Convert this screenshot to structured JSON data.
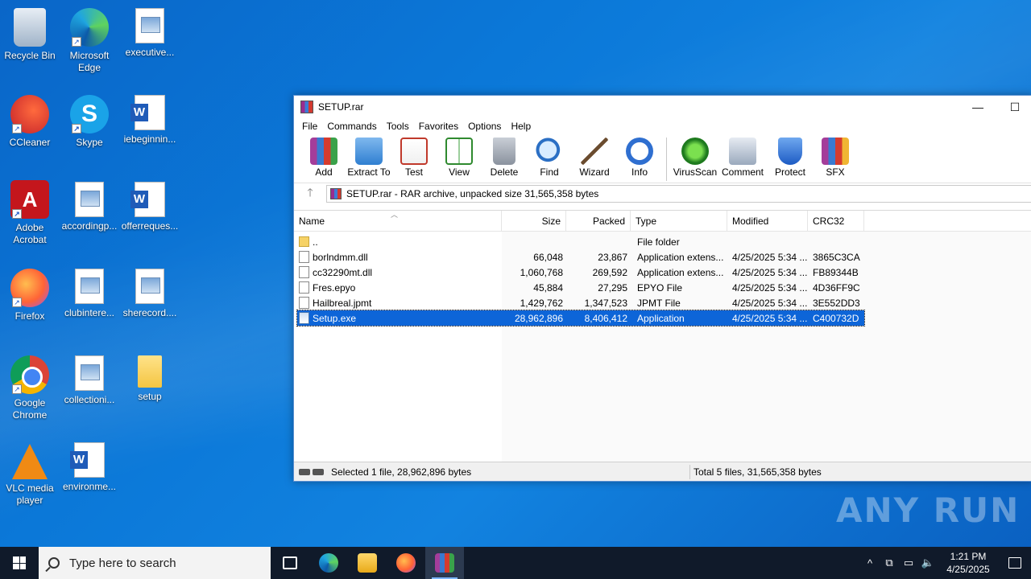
{
  "desktop": {
    "icons": [
      {
        "label": "Recycle Bin",
        "icon": "recycle-bin-icon"
      },
      {
        "label": "Microsoft Edge",
        "icon": "edge-icon"
      },
      {
        "label": "executive...",
        "icon": "image-file-icon"
      },
      {
        "label": "CCleaner",
        "icon": "ccleaner-icon"
      },
      {
        "label": "Skype",
        "icon": "skype-icon"
      },
      {
        "label": "iebeginnin...",
        "icon": "word-doc-icon"
      },
      {
        "label": "Adobe Acrobat",
        "icon": "acrobat-icon"
      },
      {
        "label": "accordingp...",
        "icon": "image-file-icon"
      },
      {
        "label": "offerreques...",
        "icon": "word-doc-icon"
      },
      {
        "label": "Firefox",
        "icon": "firefox-icon"
      },
      {
        "label": "clubintere...",
        "icon": "image-file-icon"
      },
      {
        "label": "sherecord....",
        "icon": "image-file-icon"
      },
      {
        "label": "Google Chrome",
        "icon": "chrome-icon"
      },
      {
        "label": "collectioni...",
        "icon": "image-file-icon"
      },
      {
        "label": "setup",
        "icon": "folder-icon"
      },
      {
        "label": "VLC media player",
        "icon": "vlc-icon"
      },
      {
        "label": "environme...",
        "icon": "word-doc-icon"
      }
    ]
  },
  "window": {
    "title": "SETUP.rar",
    "controls": {
      "minimize": "—",
      "maximize": "☐"
    },
    "menu": [
      "File",
      "Commands",
      "Tools",
      "Favorites",
      "Options",
      "Help"
    ],
    "toolbar": [
      {
        "label": "Add",
        "icon": "add-archive-icon"
      },
      {
        "label": "Extract To",
        "icon": "extract-folder-icon"
      },
      {
        "label": "Test",
        "icon": "test-clipboard-icon"
      },
      {
        "label": "View",
        "icon": "view-book-icon"
      },
      {
        "label": "Delete",
        "icon": "trash-icon"
      },
      {
        "label": "Find",
        "icon": "magnifier-icon"
      },
      {
        "label": "Wizard",
        "icon": "wand-icon"
      },
      {
        "label": "Info",
        "icon": "info-icon"
      },
      {
        "label": "VirusScan",
        "icon": "virus-scan-icon"
      },
      {
        "label": "Comment",
        "icon": "comment-icon"
      },
      {
        "label": "Protect",
        "icon": "shield-icon"
      },
      {
        "label": "SFX",
        "icon": "sfx-icon"
      }
    ],
    "address": {
      "up": "🡑",
      "path": "SETUP.rar - RAR archive, unpacked size 31,565,358 bytes"
    },
    "columns": {
      "name": "Name",
      "size": "Size",
      "packed": "Packed",
      "type": "Type",
      "modified": "Modified",
      "crc": "CRC32"
    },
    "files": [
      {
        "name": "..",
        "size": "",
        "packed": "",
        "type": "File folder",
        "modified": "",
        "crc": "",
        "kind": "folder",
        "selected": false
      },
      {
        "name": "borlndmm.dll",
        "size": "66,048",
        "packed": "23,867",
        "type": "Application extens...",
        "modified": "4/25/2025 5:34 ...",
        "crc": "3865C3CA",
        "kind": "dll",
        "selected": false
      },
      {
        "name": "cc32290mt.dll",
        "size": "1,060,768",
        "packed": "269,592",
        "type": "Application extens...",
        "modified": "4/25/2025 5:34 ...",
        "crc": "FB89344B",
        "kind": "dll",
        "selected": false
      },
      {
        "name": "Fres.epyo",
        "size": "45,884",
        "packed": "27,295",
        "type": "EPYO File",
        "modified": "4/25/2025 5:34 ...",
        "crc": "4D36FF9C",
        "kind": "file",
        "selected": false
      },
      {
        "name": "Hailbreal.jpmt",
        "size": "1,429,762",
        "packed": "1,347,523",
        "type": "JPMT File",
        "modified": "4/25/2025 5:34 ...",
        "crc": "3E552DD3",
        "kind": "file",
        "selected": false
      },
      {
        "name": "Setup.exe",
        "size": "28,962,896",
        "packed": "8,406,412",
        "type": "Application",
        "modified": "4/25/2025 5:34 ...",
        "crc": "C400732D",
        "kind": "exe",
        "selected": true
      }
    ],
    "status": {
      "left": "Selected 1 file, 28,962,896 bytes",
      "right": "Total 5 files, 31,565,358 bytes"
    }
  },
  "watermark": "ANY RUN",
  "taskbar": {
    "search_placeholder": "Type here to search",
    "apps": [
      "task-view",
      "edge",
      "file-explorer",
      "firefox",
      "winrar"
    ],
    "active_app": "winrar",
    "tray": {
      "chevron": "^",
      "time": "1:21 PM",
      "date": "4/25/2025"
    }
  }
}
